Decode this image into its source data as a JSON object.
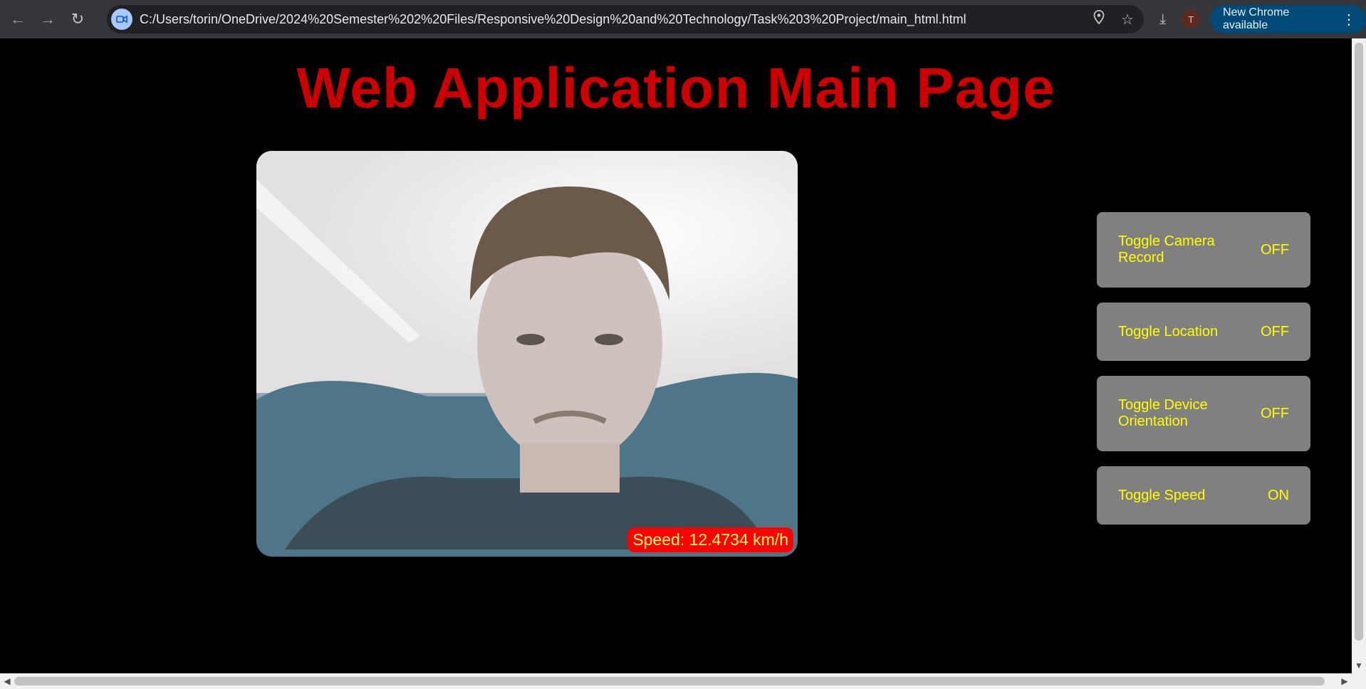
{
  "browser": {
    "url": "C:/Users/torin/OneDrive/2024%20Semester%202%20Files/Responsive%20Design%20and%20Technology/Task%203%20Project/main_html.html",
    "avatar_initial": "T",
    "update_label": "New Chrome available"
  },
  "page": {
    "title": "Web Application Main Page",
    "speed_overlay": "Speed: 12.4734 km/h"
  },
  "controls": [
    {
      "label": "Toggle Camera Record",
      "state": "OFF"
    },
    {
      "label": "Toggle Location",
      "state": "OFF"
    },
    {
      "label": "Toggle Device Orientation",
      "state": "OFF"
    },
    {
      "label": "Toggle Speed",
      "state": "ON"
    }
  ],
  "colors": {
    "title": "#cc0000",
    "toggle_bg": "#808080",
    "toggle_text": "#ffff00",
    "speed_bg": "#ff0000"
  }
}
